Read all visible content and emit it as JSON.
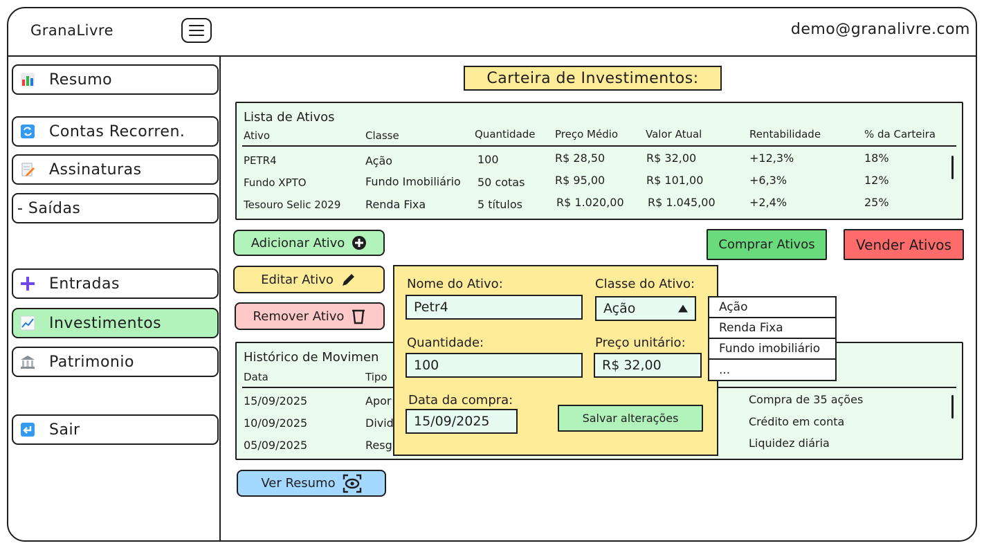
{
  "app": {
    "title": "GranaLivre",
    "user_email": "demo@granalivre.com"
  },
  "sidebar": {
    "items": [
      {
        "label": "Resumo",
        "icon": "bar-chart-icon"
      },
      {
        "label": "Contas Recorren.",
        "icon": "refresh-icon"
      },
      {
        "label": "Assinaturas",
        "icon": "memo-icon"
      },
      {
        "label": "- Saídas",
        "icon": ""
      },
      {
        "label": "Entradas",
        "icon": "plus-icon"
      },
      {
        "label": "Investimentos",
        "icon": "chart-up-icon",
        "active": true
      },
      {
        "label": "Patrimonio",
        "icon": "bank-icon"
      },
      {
        "label": "Sair",
        "icon": "exit-icon"
      }
    ]
  },
  "page_title": "Carteira de Investimentos:",
  "assets": {
    "title": "Lista de Ativos",
    "columns": [
      "Ativo",
      "Classe",
      "Quantidade",
      "Preço Médio",
      "Valor Atual",
      "Rentabilidade",
      "% da Carteira"
    ],
    "rows": [
      [
        "PETR4",
        "Ação",
        "100",
        "R$ 28,50",
        "R$ 32,00",
        "+12,3%",
        "18%"
      ],
      [
        "Fundo XPTO",
        "Fundo Imobiliário",
        "50 cotas",
        "R$ 95,00",
        "R$ 101,00",
        "+6,3%",
        "12%"
      ],
      [
        "Tesouro Selic 2029",
        "Renda Fixa",
        "5 títulos",
        "R$ 1.020,00",
        "R$ 1.045,00",
        "+2,4%",
        "25%"
      ]
    ]
  },
  "actions": {
    "add": "Adicionar Ativo",
    "edit": "Editar Ativo",
    "remove": "Remover Ativo",
    "buy": "Comprar Ativos",
    "sell": "Vender Ativos",
    "summary": "Ver Resumo"
  },
  "history": {
    "title": "Histórico de Movimen",
    "columns": [
      "Data",
      "Tipo"
    ],
    "rows": [
      {
        "date": "15/09/2025",
        "type": "Apor",
        "note": "Compra de 35 ações"
      },
      {
        "date": "10/09/2025",
        "type": "Divid",
        "note": "Crédito em conta"
      },
      {
        "date": "05/09/2025",
        "type": "Resg",
        "note": "Liquidez diária"
      }
    ]
  },
  "edit_form": {
    "name_label": "Nome do Ativo:",
    "name_value": "Petr4",
    "class_label": "Classe do Ativo:",
    "class_value": "Ação",
    "quantity_label": "Quantidade:",
    "quantity_value": "100",
    "price_label": "Preço unitário:",
    "price_value": "R$ 32,00",
    "date_label": "Data da compra:",
    "date_value": "15/09/2025",
    "save_label": "Salvar alterações",
    "class_options": [
      "Ação",
      "Renda Fixa",
      "Fundo imobiliário",
      "..."
    ]
  },
  "colors": {
    "active_green": "#b2f2bb",
    "panel_green": "#ebfbee",
    "yellow": "#ffec99",
    "red": "#ff6b6b",
    "pink": "#ffc9c9",
    "blue": "#a5d8ff",
    "save_green": "#8ce99a"
  }
}
